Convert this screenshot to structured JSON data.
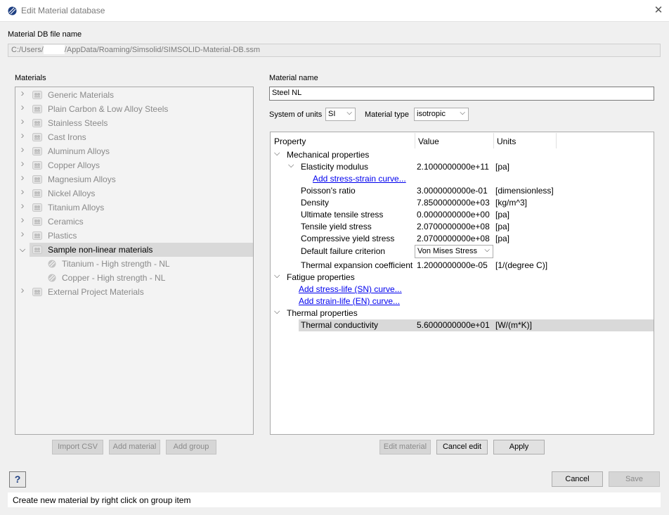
{
  "window": {
    "title": "Edit Material database",
    "close_label": "✕"
  },
  "file": {
    "label": "Material DB file name",
    "path_prefix": "C:/Users/",
    "path_suffix": "/AppData/Roaming/Simsolid/SIMSOLID-Material-DB.ssm"
  },
  "materials": {
    "label": "Materials",
    "groups": [
      {
        "label": "Generic Materials"
      },
      {
        "label": "Plain Carbon & Low Alloy Steels"
      },
      {
        "label": "Stainless Steels"
      },
      {
        "label": "Cast Irons"
      },
      {
        "label": "Aluminum Alloys"
      },
      {
        "label": "Copper Alloys"
      },
      {
        "label": "Magnesium Alloys"
      },
      {
        "label": "Nickel Alloys"
      },
      {
        "label": "Titanium Alloys"
      },
      {
        "label": "Ceramics"
      },
      {
        "label": "Plastics"
      },
      {
        "label": "Sample non-linear materials"
      },
      {
        "label": "External Project Materials"
      }
    ],
    "children": [
      {
        "label": "Titanium - High strength - NL"
      },
      {
        "label": "Copper - High strength - NL"
      }
    ],
    "buttons": {
      "import_csv": "Import CSV",
      "add_material": "Add material",
      "add_group": "Add group"
    }
  },
  "editor": {
    "name_label": "Material name",
    "name_value": "Steel NL",
    "units_label": "System of units",
    "units_value": "SI",
    "type_label": "Material type",
    "type_value": "isotropic",
    "headers": {
      "property": "Property",
      "value": "Value",
      "units": "Units"
    },
    "mechanical": {
      "label": "Mechanical properties",
      "elasticity": {
        "label": "Elasticity modulus",
        "value": "2.1000000000e+11",
        "units": "[pa]"
      },
      "add_stress_strain": "Add stress-strain curve...",
      "rows": [
        {
          "label": "Poisson's ratio",
          "value": "3.0000000000e-01",
          "units": "[dimensionless]"
        },
        {
          "label": "Density",
          "value": "7.8500000000e+03",
          "units": "[kg/m^3]"
        },
        {
          "label": "Ultimate tensile stress",
          "value": "0.0000000000e+00",
          "units": "[pa]"
        },
        {
          "label": "Tensile yield stress",
          "value": "2.0700000000e+08",
          "units": "[pa]"
        },
        {
          "label": "Compressive yield stress",
          "value": "2.0700000000e+08",
          "units": "[pa]"
        }
      ],
      "failure": {
        "label": "Default failure criterion",
        "value": "Von Mises Stress"
      },
      "thermal_expansion": {
        "label": "Thermal expansion coefficient",
        "value": "1.2000000000e-05",
        "units": "[1/(degree C)]"
      }
    },
    "fatigue": {
      "label": "Fatigue properties",
      "add_sn": "Add stress-life (SN) curve...",
      "add_en": "Add strain-life (EN) curve..."
    },
    "thermal": {
      "label": "Thermal properties",
      "conductivity": {
        "label": "Thermal conductivity",
        "value": "5.6000000000e+01",
        "units": "[W/(m*K)]"
      }
    },
    "buttons": {
      "edit_material": "Edit material",
      "cancel_edit": "Cancel edit",
      "apply": "Apply"
    }
  },
  "footer": {
    "help": "?",
    "cancel": "Cancel",
    "save": "Save",
    "status": "Create new material by right click on group item"
  },
  "colors": {
    "link": "#0000ee",
    "selection": "#d9d9d9",
    "disabled_text": "#8a8a8a"
  }
}
